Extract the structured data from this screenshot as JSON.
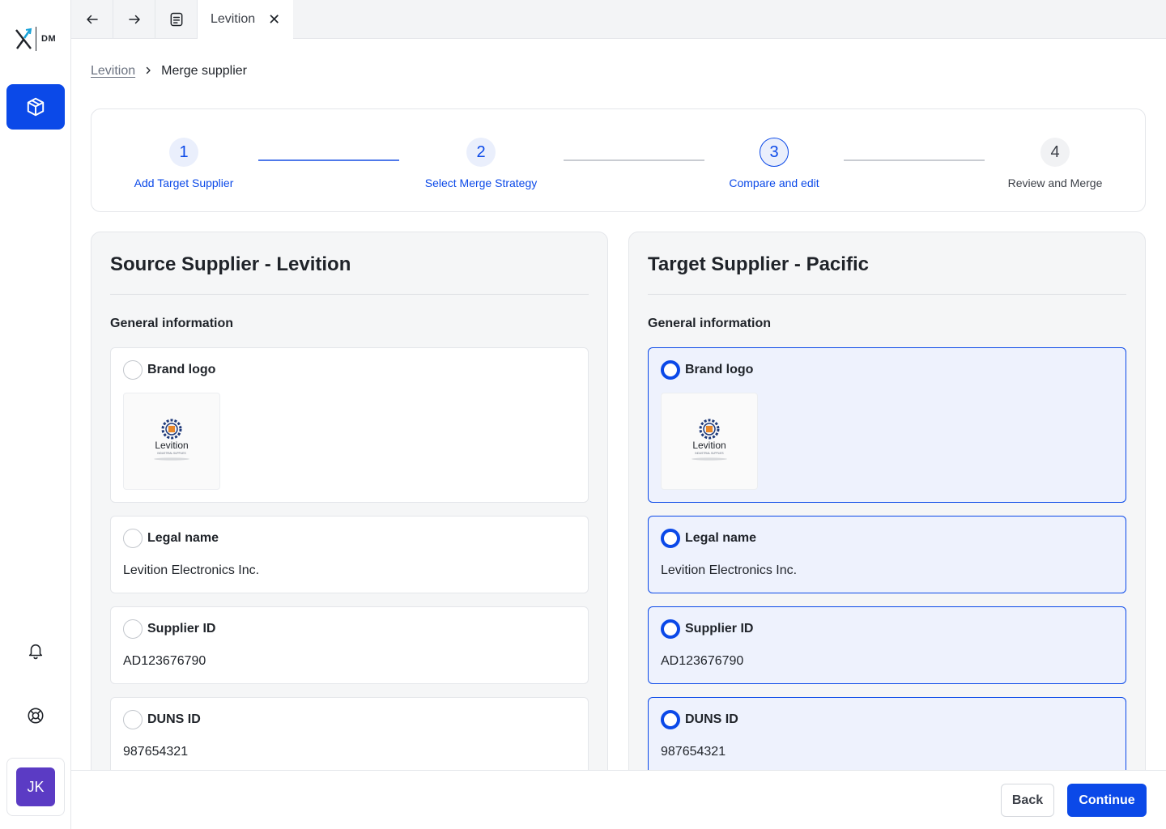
{
  "brand": {
    "short": "DM",
    "accent": "#0b49e8"
  },
  "user": {
    "initials": "JK"
  },
  "tabs": {
    "active_label": "Levition"
  },
  "breadcrumb": {
    "parent": "Levition",
    "current": "Merge supplier"
  },
  "stepper": {
    "steps": [
      {
        "num": "1",
        "label": "Add Target Supplier",
        "state": "done"
      },
      {
        "num": "2",
        "label": "Select Merge Strategy",
        "state": "done"
      },
      {
        "num": "3",
        "label": "Compare and edit",
        "state": "current"
      },
      {
        "num": "4",
        "label": "Review and Merge",
        "state": "future"
      }
    ]
  },
  "source": {
    "title": "Source Supplier - Levition",
    "section": "General information",
    "fields": [
      {
        "label": "Brand logo",
        "logo_text": "Levition",
        "logo_sub": "INDUSTRIAL SUPPLIES",
        "selected": false
      },
      {
        "label": "Legal name",
        "value": "Levition Electronics Inc.",
        "selected": false
      },
      {
        "label": "Supplier ID",
        "value": "AD123676790",
        "selected": false
      },
      {
        "label": "DUNS ID",
        "value": "987654321",
        "selected": false
      }
    ]
  },
  "target": {
    "title": "Target Supplier - Pacific",
    "section": "General information",
    "fields": [
      {
        "label": "Brand logo",
        "logo_text": "Levition",
        "logo_sub": "INDUSTRIAL SUPPLIES",
        "selected": true
      },
      {
        "label": "Legal name",
        "value": "Levition Electronics Inc.",
        "selected": true
      },
      {
        "label": "Supplier ID",
        "value": "AD123676790",
        "selected": true
      },
      {
        "label": "DUNS ID",
        "value": "987654321",
        "selected": true
      }
    ]
  },
  "footer": {
    "back_label": "Back",
    "continue_label": "Continue"
  }
}
